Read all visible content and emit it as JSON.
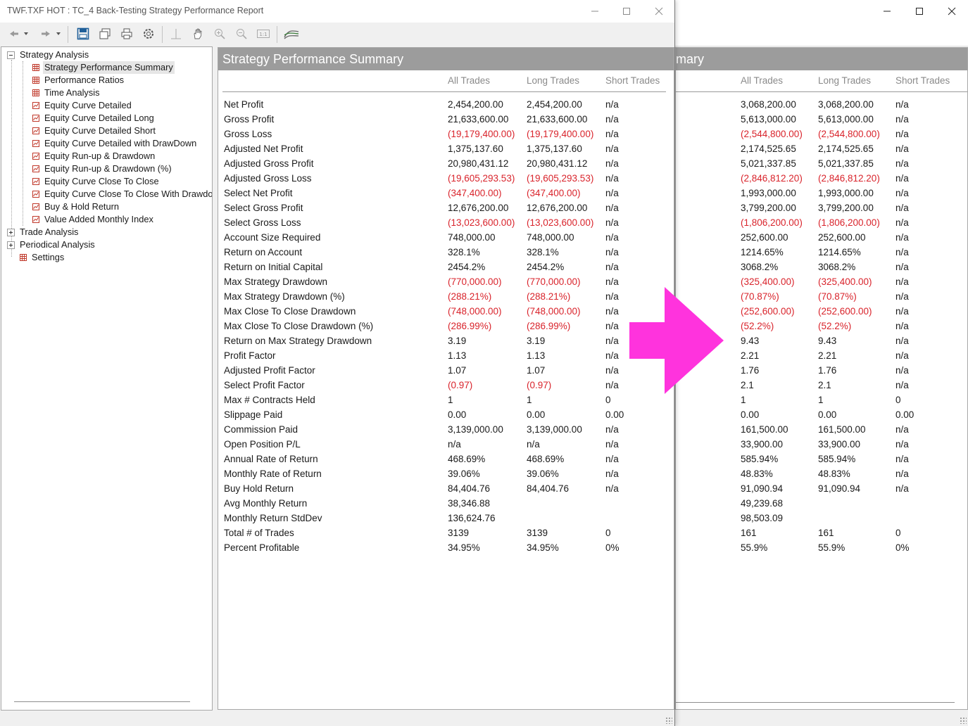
{
  "left_window": {
    "title": "TWF.TXF HOT : TC_4 Back-Testing Strategy Performance Report",
    "report_title": "Strategy Performance Summary",
    "columns": [
      "All Trades",
      "Long Trades",
      "Short Trades"
    ],
    "tree": [
      {
        "label": "Strategy Analysis",
        "level": 0,
        "expander": "minus"
      },
      {
        "label": "Strategy Performance Summary",
        "level": 1,
        "icon": "table-icon",
        "selected": true
      },
      {
        "label": "Performance Ratios",
        "level": 1,
        "icon": "table-icon"
      },
      {
        "label": "Time Analysis",
        "level": 1,
        "icon": "table-icon"
      },
      {
        "label": "Equity Curve Detailed",
        "level": 1,
        "icon": "chart-icon"
      },
      {
        "label": "Equity Curve Detailed Long",
        "level": 1,
        "icon": "chart-icon"
      },
      {
        "label": "Equity Curve Detailed Short",
        "level": 1,
        "icon": "chart-icon"
      },
      {
        "label": "Equity Curve Detailed with DrawDown",
        "level": 1,
        "icon": "chart-icon"
      },
      {
        "label": "Equity Run-up & Drawdown",
        "level": 1,
        "icon": "chart-icon"
      },
      {
        "label": "Equity Run-up & Drawdown (%)",
        "level": 1,
        "icon": "chart-icon"
      },
      {
        "label": "Equity Curve Close To Close",
        "level": 1,
        "icon": "chart-icon"
      },
      {
        "label": "Equity Curve Close To Close With Drawdov",
        "level": 1,
        "icon": "chart-icon"
      },
      {
        "label": "Buy & Hold Return",
        "level": 1,
        "icon": "chart-icon"
      },
      {
        "label": "Value Added Monthly Index",
        "level": 1,
        "icon": "chart-icon"
      },
      {
        "label": "Trade Analysis",
        "level": 0,
        "expander": "plus"
      },
      {
        "label": "Periodical Analysis",
        "level": 0,
        "expander": "plus"
      },
      {
        "label": "Settings",
        "level": 0,
        "icon": "table-icon"
      }
    ],
    "metrics": [
      {
        "name": "Net Profit",
        "all": "2,454,200.00",
        "long": "2,454,200.00",
        "short": "n/a"
      },
      {
        "name": "Gross Profit",
        "all": "21,633,600.00",
        "long": "21,633,600.00",
        "short": "n/a"
      },
      {
        "name": "Gross Loss",
        "all": "(19,179,400.00)",
        "long": "(19,179,400.00)",
        "short": "n/a"
      },
      {
        "name": "Adjusted Net Profit",
        "all": "1,375,137.60",
        "long": "1,375,137.60",
        "short": "n/a"
      },
      {
        "name": "Adjusted Gross Profit",
        "all": "20,980,431.12",
        "long": "20,980,431.12",
        "short": "n/a"
      },
      {
        "name": "Adjusted Gross Loss",
        "all": "(19,605,293.53)",
        "long": "(19,605,293.53)",
        "short": "n/a"
      },
      {
        "name": "Select Net Profit",
        "all": "(347,400.00)",
        "long": "(347,400.00)",
        "short": "n/a"
      },
      {
        "name": "Select Gross Profit",
        "all": "12,676,200.00",
        "long": "12,676,200.00",
        "short": "n/a"
      },
      {
        "name": "Select Gross Loss",
        "all": "(13,023,600.00)",
        "long": "(13,023,600.00)",
        "short": "n/a"
      },
      {
        "name": "Account Size Required",
        "all": "748,000.00",
        "long": "748,000.00",
        "short": "n/a"
      },
      {
        "name": "Return on Account",
        "all": "328.1%",
        "long": "328.1%",
        "short": "n/a"
      },
      {
        "name": "Return on Initial Capital",
        "all": "2454.2%",
        "long": "2454.2%",
        "short": "n/a"
      },
      {
        "name": "Max Strategy Drawdown",
        "all": "(770,000.00)",
        "long": "(770,000.00)",
        "short": "n/a"
      },
      {
        "name": "Max Strategy Drawdown (%)",
        "all": "(288.21%)",
        "long": "(288.21%)",
        "short": "n/a"
      },
      {
        "name": "Max Close To Close Drawdown",
        "all": "(748,000.00)",
        "long": "(748,000.00)",
        "short": "n/a"
      },
      {
        "name": "Max Close To Close Drawdown (%)",
        "all": "(286.99%)",
        "long": "(286.99%)",
        "short": "n/a"
      },
      {
        "name": "Return on Max Strategy Drawdown",
        "all": "3.19",
        "long": "3.19",
        "short": "n/a"
      },
      {
        "name": "Profit Factor",
        "all": "1.13",
        "long": "1.13",
        "short": "n/a"
      },
      {
        "name": "Adjusted Profit Factor",
        "all": "1.07",
        "long": "1.07",
        "short": "n/a"
      },
      {
        "name": "Select Profit Factor",
        "all": "(0.97)",
        "long": "(0.97)",
        "short": "n/a"
      },
      {
        "name": "Max # Contracts Held",
        "all": "1",
        "long": "1",
        "short": "0"
      },
      {
        "name": "Slippage Paid",
        "all": "0.00",
        "long": "0.00",
        "short": "0.00"
      },
      {
        "name": "Commission Paid",
        "all": "3,139,000.00",
        "long": "3,139,000.00",
        "short": "n/a"
      },
      {
        "name": "Open Position P/L",
        "all": "n/a",
        "long": "n/a",
        "short": "n/a"
      },
      {
        "name": "Annual Rate of Return",
        "all": "468.69%",
        "long": "468.69%",
        "short": "n/a"
      },
      {
        "name": "Monthly Rate of Return",
        "all": "39.06%",
        "long": "39.06%",
        "short": "n/a"
      },
      {
        "name": "Buy  Hold Return",
        "all": "84,404.76",
        "long": "84,404.76",
        "short": "n/a"
      },
      {
        "name": "Avg Monthly Return",
        "all": "38,346.88",
        "long": "",
        "short": ""
      },
      {
        "name": "Monthly Return StdDev",
        "all": "136,624.76",
        "long": "",
        "short": ""
      },
      {
        "name": "Total # of Trades",
        "all": "3139",
        "long": "3139",
        "short": "0"
      },
      {
        "name": "Percent Profitable",
        "all": "34.95%",
        "long": "34.95%",
        "short": "0%"
      }
    ]
  },
  "right_window": {
    "report_title_fragment": "mary",
    "columns": [
      "All Trades",
      "Long Trades",
      "Short Trades"
    ],
    "metrics": [
      {
        "all": "3,068,200.00",
        "long": "3,068,200.00",
        "short": "n/a"
      },
      {
        "all": "5,613,000.00",
        "long": "5,613,000.00",
        "short": "n/a"
      },
      {
        "all": "(2,544,800.00)",
        "long": "(2,544,800.00)",
        "short": "n/a"
      },
      {
        "all": "2,174,525.65",
        "long": "2,174,525.65",
        "short": "n/a"
      },
      {
        "all": "5,021,337.85",
        "long": "5,021,337.85",
        "short": "n/a"
      },
      {
        "all": "(2,846,812.20)",
        "long": "(2,846,812.20)",
        "short": "n/a"
      },
      {
        "all": "1,993,000.00",
        "long": "1,993,000.00",
        "short": "n/a"
      },
      {
        "all": "3,799,200.00",
        "long": "3,799,200.00",
        "short": "n/a"
      },
      {
        "all": "(1,806,200.00)",
        "long": "(1,806,200.00)",
        "short": "n/a"
      },
      {
        "all": "252,600.00",
        "long": "252,600.00",
        "short": "n/a"
      },
      {
        "all": "1214.65%",
        "long": "1214.65%",
        "short": "n/a"
      },
      {
        "all": "3068.2%",
        "long": "3068.2%",
        "short": "n/a"
      },
      {
        "all": "(325,400.00)",
        "long": "(325,400.00)",
        "short": "n/a"
      },
      {
        "all": "(70.87%)",
        "long": "(70.87%)",
        "short": "n/a"
      },
      {
        "all": "(252,600.00)",
        "long": "(252,600.00)",
        "short": "n/a"
      },
      {
        "all": "(52.2%)",
        "long": "(52.2%)",
        "short": "n/a"
      },
      {
        "all": "9.43",
        "long": "9.43",
        "short": "n/a"
      },
      {
        "all": "2.21",
        "long": "2.21",
        "short": "n/a"
      },
      {
        "all": "1.76",
        "long": "1.76",
        "short": "n/a"
      },
      {
        "all": "2.1",
        "long": "2.1",
        "short": "n/a"
      },
      {
        "all": "1",
        "long": "1",
        "short": "0"
      },
      {
        "all": "0.00",
        "long": "0.00",
        "short": "0.00"
      },
      {
        "all": "161,500.00",
        "long": "161,500.00",
        "short": "n/a"
      },
      {
        "all": "33,900.00",
        "long": "33,900.00",
        "short": "n/a"
      },
      {
        "all": "585.94%",
        "long": "585.94%",
        "short": "n/a"
      },
      {
        "all": "48.83%",
        "long": "48.83%",
        "short": "n/a"
      },
      {
        "all": "91,090.94",
        "long": "91,090.94",
        "short": "n/a"
      },
      {
        "all": "49,239.68",
        "long": "",
        "short": ""
      },
      {
        "all": "98,503.09",
        "long": "",
        "short": ""
      },
      {
        "all": "161",
        "long": "161",
        "short": "0"
      },
      {
        "all": "55.9%",
        "long": "55.9%",
        "short": "0%"
      }
    ]
  },
  "colors": {
    "negative": "#d9232b",
    "header_bg": "#9c9c9c",
    "arrow": "#ff33dd"
  },
  "toolbar_icons": [
    "back-icon",
    "dropdown-icon",
    "forward-icon",
    "dropdown-icon",
    "save-icon",
    "copy-icon",
    "print-icon",
    "settings-icon",
    "crosshair-icon",
    "pan-hand-icon",
    "zoom-in-icon",
    "zoom-out-icon",
    "zoom-reset-icon",
    "chart-style-icon"
  ],
  "window_controls": {
    "minimize": "minimize-icon",
    "maximize": "maximize-icon",
    "close": "close-icon"
  }
}
